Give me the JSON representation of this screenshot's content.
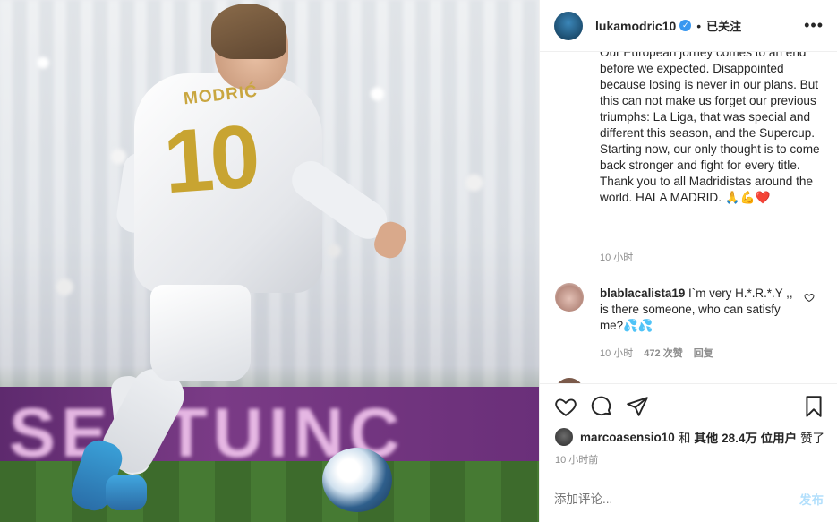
{
  "post": {
    "image": {
      "jersey_name": "MODRIĆ",
      "jersey_number": "10",
      "board_text": "SEPTUINC"
    },
    "header": {
      "username": "lukamodric10",
      "verified_icon": "verified-badge-icon",
      "separator": "•",
      "follow_label": "已关注",
      "more_label": "•••"
    },
    "caption": {
      "text": "Our European jorney comes to an end before we expected. Disappointed because losing is never in our plans. But this can not make us forget our previous triumphs: La Liga, that was special and different this season, and the Supercup.\nStarting now, our only thought is to come back stronger and fight for every title. Thank you to all Madridistas around the world. HALA MADRID. 🙏💪❤️",
      "time": "10 小时"
    },
    "comment": {
      "username": "blablacalista19",
      "text": "I`m very H.*.R.*.Y ,, is there someone, who can satisfy me?💦💦",
      "time": "10 小时",
      "likes": "472 次赞",
      "reply": "回复"
    },
    "likes": {
      "user": "marcoasensio10",
      "and": "和",
      "others": "其他 28.4万 位用户",
      "suffix": "赞了"
    },
    "post_time": "10 小时前",
    "comment_input": {
      "placeholder": "添加评论...",
      "post_label": "发布"
    },
    "colors": {
      "accent": "#3897f0",
      "post_button_disabled": "#b2dffc",
      "muted_text": "#8e8e8e",
      "border": "#efefef"
    }
  }
}
